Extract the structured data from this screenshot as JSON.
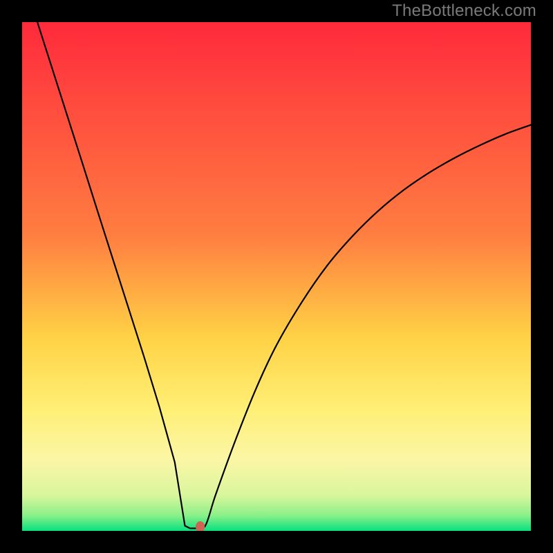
{
  "watermark": "TheBottleneck.com",
  "chart_data": {
    "type": "line",
    "title": "",
    "xlabel": "",
    "ylabel": "",
    "xlim": [
      0,
      100
    ],
    "ylim": [
      0,
      100
    ],
    "background_gradient": {
      "stops": [
        {
          "offset": 0,
          "color": "#ff2a3c"
        },
        {
          "offset": 42,
          "color": "#ff7e41"
        },
        {
          "offset": 62,
          "color": "#ffd245"
        },
        {
          "offset": 76,
          "color": "#ffef75"
        },
        {
          "offset": 86,
          "color": "#fbf6a6"
        },
        {
          "offset": 93,
          "color": "#d9f69c"
        },
        {
          "offset": 97,
          "color": "#8af089"
        },
        {
          "offset": 100,
          "color": "#04e27e"
        }
      ]
    },
    "curve": {
      "description": "V-shaped bottleneck curve with minimum near x≈34, rising asymptotically to the right.",
      "points": [
        {
          "x": 3,
          "y": 100
        },
        {
          "x": 6,
          "y": 90.6
        },
        {
          "x": 9,
          "y": 81.2
        },
        {
          "x": 12,
          "y": 71.8
        },
        {
          "x": 15,
          "y": 62.3
        },
        {
          "x": 18,
          "y": 52.9
        },
        {
          "x": 21,
          "y": 43.5
        },
        {
          "x": 24,
          "y": 34.1
        },
        {
          "x": 27,
          "y": 24.3
        },
        {
          "x": 30,
          "y": 13.5
        },
        {
          "x": 32,
          "y": 1.0
        },
        {
          "x": 33,
          "y": 0.5
        },
        {
          "x": 34,
          "y": 0.5
        },
        {
          "x": 36,
          "y": 1.0
        },
        {
          "x": 38,
          "y": 7.0
        },
        {
          "x": 42,
          "y": 18.0
        },
        {
          "x": 46,
          "y": 28.0
        },
        {
          "x": 50,
          "y": 36.5
        },
        {
          "x": 55,
          "y": 45.0
        },
        {
          "x": 60,
          "y": 52.2
        },
        {
          "x": 65,
          "y": 58.0
        },
        {
          "x": 70,
          "y": 62.9
        },
        {
          "x": 75,
          "y": 67.0
        },
        {
          "x": 80,
          "y": 70.4
        },
        {
          "x": 85,
          "y": 73.3
        },
        {
          "x": 90,
          "y": 75.8
        },
        {
          "x": 95,
          "y": 78.0
        },
        {
          "x": 100,
          "y": 79.8
        }
      ]
    },
    "marker": {
      "x": 35,
      "y": 0.8,
      "rx": 0.9,
      "ry": 1.1,
      "color": "#d06454"
    }
  }
}
